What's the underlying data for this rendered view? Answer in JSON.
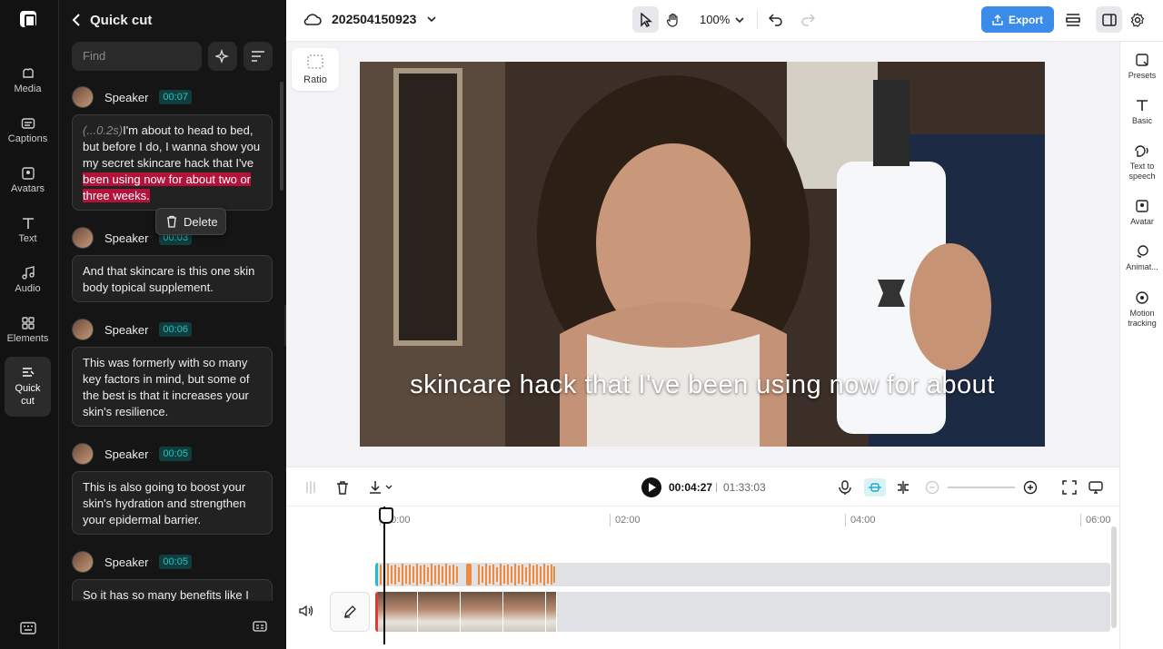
{
  "rail": {
    "items": [
      {
        "label": "Media",
        "icon": "media-icon"
      },
      {
        "label": "Captions",
        "icon": "captions-icon"
      },
      {
        "label": "Avatars",
        "icon": "avatars-icon"
      },
      {
        "label": "Text",
        "icon": "text-icon"
      },
      {
        "label": "Audio",
        "icon": "audio-icon"
      },
      {
        "label": "Elements",
        "icon": "elements-icon"
      },
      {
        "label": "Quick\ncut",
        "icon": "quick-cut-icon"
      }
    ]
  },
  "panel": {
    "title": "Quick cut",
    "search_placeholder": "Find",
    "delete_label": "Delete",
    "segments": [
      {
        "speaker": "Speaker",
        "time": "00:07",
        "pause": "(...0.2s)",
        "text": "I'm about to head to bed, but before I do, I wanna show you my secret skincare hack that I've ",
        "highlight": "been using now for about two or three weeks."
      },
      {
        "speaker": "Speaker",
        "time": "00:03",
        "text": "And that skincare is this one skin body topical supplement."
      },
      {
        "speaker": "Speaker",
        "time": "00:06",
        "text": "This was formerly with so many key factors in mind, but some of the best is that it increases your skin's resilience."
      },
      {
        "speaker": "Speaker",
        "time": "00:05",
        "text": "This is also going to boost your skin's hydration and strengthen your epidermal barrier."
      },
      {
        "speaker": "Speaker",
        "time": "00:05",
        "text": "So it has so many benefits like I"
      }
    ]
  },
  "topbar": {
    "project_name": "202504150923",
    "zoom": "100%",
    "export_label": "Export"
  },
  "stage": {
    "ratio_label": "Ratio",
    "caption": "skincare hack that I've been using now for about"
  },
  "right_rail": {
    "items": [
      {
        "label": "Presets"
      },
      {
        "label": "Basic"
      },
      {
        "label": "Text to speech"
      },
      {
        "label": "Avatar"
      },
      {
        "label": "Animat..."
      },
      {
        "label": "Motion tracking"
      }
    ]
  },
  "timeline": {
    "current_time": "00:04:27",
    "separator": "|",
    "total_time": "01:33:03",
    "ticks": [
      "00:00",
      "02:00",
      "04:00",
      "06:00"
    ]
  },
  "colors": {
    "accent": "#3a8ce8",
    "highlight": "#b3123b",
    "timestamp": "#24c4c4",
    "waveform": "#f08a3a"
  }
}
